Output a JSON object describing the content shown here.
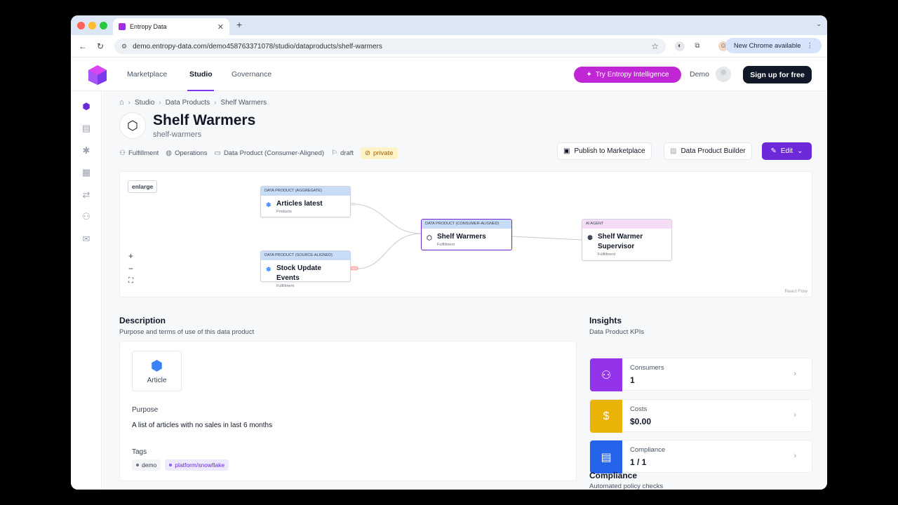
{
  "browser": {
    "tab_title": "Entropy Data",
    "url": "demo.entropy-data.com/demo458763371078/studio/dataproducts/shelf-warmers",
    "new_chrome": "New Chrome available"
  },
  "header": {
    "nav": [
      "Marketplace",
      "Studio",
      "Governance"
    ],
    "try_button": "Try Entropy Intelligence",
    "user": "Demo",
    "signup": "Sign up for free"
  },
  "breadcrumb": [
    "Studio",
    "Data Products",
    "Shelf Warmers"
  ],
  "product": {
    "title": "Shelf Warmers",
    "slug": "shelf-warmers",
    "team": "Fulfillment",
    "domain": "Operations",
    "type": "Data Product (Consumer-Aligned)",
    "status": "draft",
    "visibility": "private"
  },
  "actions": {
    "publish": "Publish to Marketplace",
    "builder": "Data Product Builder",
    "edit": "Edit"
  },
  "flow": {
    "enlarge": "enlarge",
    "attribution": "React Flow",
    "zoom_in": "+",
    "zoom_out": "−",
    "fit": "⛶",
    "nodes": [
      {
        "kind": "DATA PRODUCT (AGGREGATE)",
        "title": "Articles latest",
        "sub": "Products"
      },
      {
        "kind": "DATA PRODUCT (SOURCE-ALIGNED)",
        "title": "Stock Update Events",
        "sub": "Fulfillment"
      },
      {
        "kind": "DATA PRODUCT (CONSUMER-ALIGNED)",
        "title": "Shelf Warmers",
        "sub": "Fulfillment"
      },
      {
        "kind": "AI AGENT",
        "title": "Shelf Warmer Supervisor",
        "sub": "Fulfillment"
      }
    ]
  },
  "description": {
    "heading": "Description",
    "subheading": "Purpose and terms of use of this data product",
    "entity": "Article",
    "purpose_label": "Purpose",
    "purpose": "A list of articles with no sales in last 6 months",
    "tags_label": "Tags",
    "tags": [
      "demo",
      "platform/snowflake"
    ]
  },
  "insights": {
    "heading": "Insights",
    "subheading": "Data Product KPIs",
    "kpis": [
      {
        "label": "Consumers",
        "value": "1",
        "color": "#9333ea"
      },
      {
        "label": "Costs",
        "value": "$0.00",
        "color": "#eab308"
      },
      {
        "label": "Compliance",
        "value": "1 / 1",
        "color": "#2563eb"
      }
    ]
  },
  "compliance": {
    "heading": "Compliance",
    "subheading": "Automated policy checks"
  }
}
